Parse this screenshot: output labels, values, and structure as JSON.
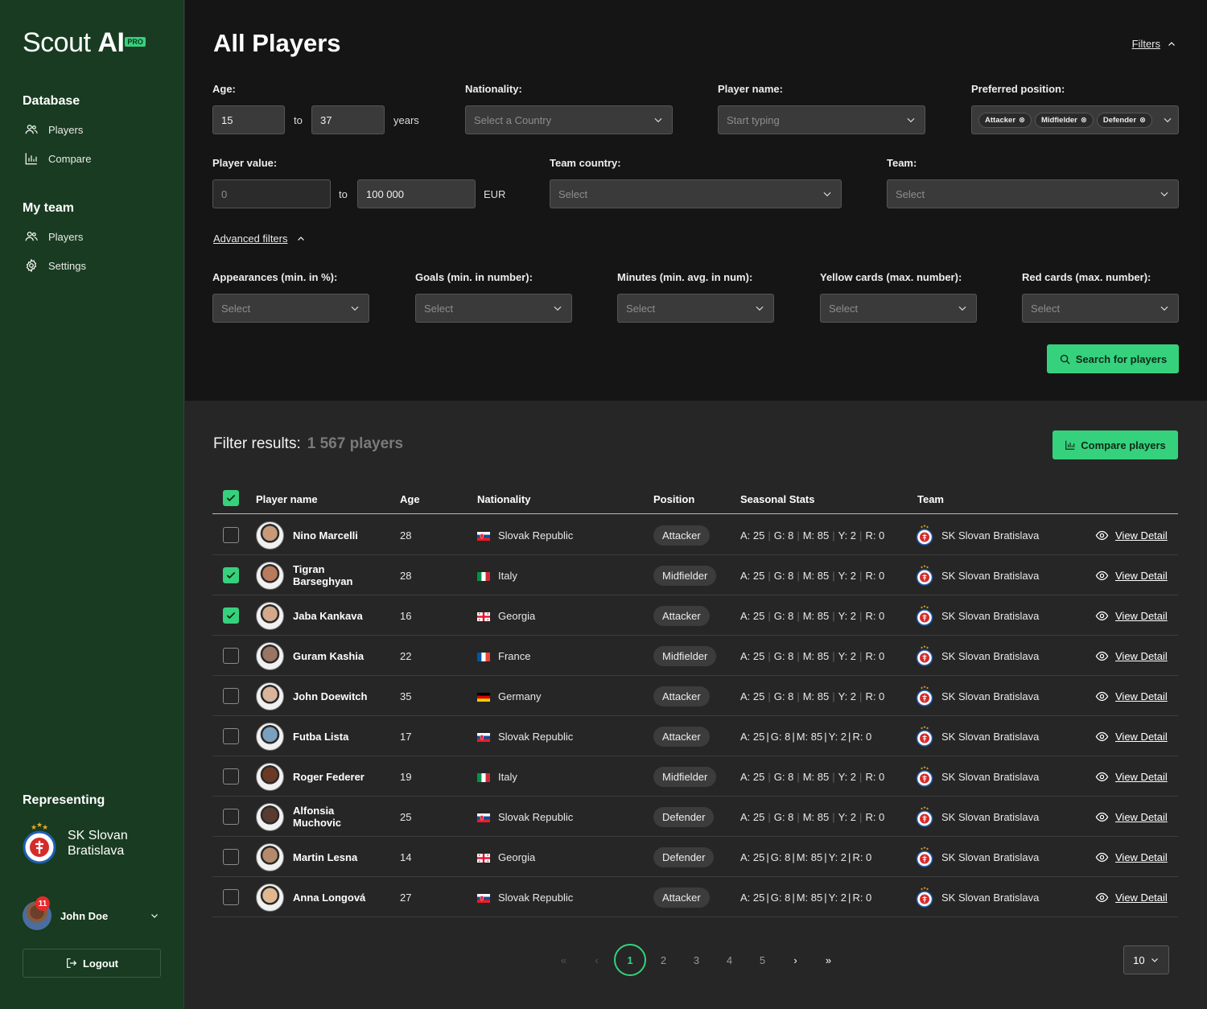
{
  "app": {
    "logo_text_light": "Scout ",
    "logo_text_bold": "AI",
    "logo_badge": "PRO"
  },
  "sidebar": {
    "database_heading": "Database",
    "database_items": [
      {
        "label": "Players",
        "icon": "users-icon"
      },
      {
        "label": "Compare",
        "icon": "bar-chart-icon"
      }
    ],
    "myteam_heading": "My team",
    "myteam_items": [
      {
        "label": "Players",
        "icon": "users-icon"
      },
      {
        "label": "Settings",
        "icon": "gear-icon"
      }
    ],
    "representing_heading": "Representing",
    "club_name": "SK Slovan Bratislava",
    "user_name": "John Doe",
    "notification_count": "11",
    "logout_label": "Logout"
  },
  "filters": {
    "page_title": "All Players",
    "toggle_label": "Filters",
    "age_label": "Age:",
    "age_from": "15",
    "age_to": "37",
    "to_word": "to",
    "years_word": "years",
    "nationality_label": "Nationality:",
    "nationality_placeholder": "Select a Country",
    "player_name_label": "Player name:",
    "player_name_placeholder": "Start typing",
    "position_label": "Preferred position:",
    "position_chips": [
      "Attacker",
      "Midfielder",
      "Defender"
    ],
    "value_label": "Player value:",
    "value_from_placeholder": "0",
    "value_to": "100 000",
    "currency": "EUR",
    "team_country_label": "Team country:",
    "team_label": "Team:",
    "select_placeholder": "Select",
    "advanced_label": "Advanced filters",
    "advanced": [
      "Appearances (min. in %):",
      "Goals (min. in number):",
      "Minutes (min. avg. in num):",
      "Yellow cards (max. number):",
      "Red cards (max. number):"
    ],
    "search_button": "Search for players"
  },
  "results": {
    "title": "Filter results:",
    "count": "1 567 players",
    "compare_button": "Compare players",
    "columns": [
      "Player name",
      "Age",
      "Nationality",
      "Position",
      "Seasonal Stats",
      "Team"
    ],
    "view_detail_label": "View Detail",
    "rows": [
      {
        "name": "Nino Marcelli",
        "age": "28",
        "nationality": "Slovak Republic",
        "flag": "sk",
        "position": "Attacker",
        "stats": [
          "A: 25",
          "G: 8",
          "M: 85",
          "Y: 2",
          "R: 0"
        ],
        "bold_sep": false,
        "team": "SK Slovan Bratislava",
        "checked": false,
        "avatar": "#c89a7a"
      },
      {
        "name": "Tigran Barseghyan",
        "age": "28",
        "nationality": "Italy",
        "flag": "it",
        "position": "Midfielder",
        "stats": [
          "A: 25",
          "G: 8",
          "M: 85",
          "Y: 2",
          "R: 0"
        ],
        "bold_sep": false,
        "team": "SK Slovan Bratislava",
        "checked": true,
        "avatar": "#b97b5d"
      },
      {
        "name": "Jaba Kankava",
        "age": "16",
        "nationality": "Georgia",
        "flag": "ge",
        "position": "Attacker",
        "stats": [
          "A: 25",
          "G: 8",
          "M: 85",
          "Y: 2",
          "R: 0"
        ],
        "bold_sep": false,
        "team": "SK Slovan Bratislava",
        "checked": true,
        "avatar": "#d4a88a"
      },
      {
        "name": "Guram Kashia",
        "age": "22",
        "nationality": "France",
        "flag": "fr",
        "position": "Midfielder",
        "stats": [
          "A: 25",
          "G: 8",
          "M: 85",
          "Y: 2",
          "R: 0"
        ],
        "bold_sep": false,
        "team": "SK Slovan Bratislava",
        "checked": false,
        "avatar": "#9a7564"
      },
      {
        "name": "John Doewitch",
        "age": "35",
        "nationality": "Germany",
        "flag": "de",
        "position": "Attacker",
        "stats": [
          "A: 25",
          "G: 8",
          "M: 85",
          "Y: 2",
          "R: 0"
        ],
        "bold_sep": false,
        "team": "SK Slovan Bratislava",
        "checked": false,
        "avatar": "#d8b49a"
      },
      {
        "name": "Futba Lista",
        "age": "17",
        "nationality": "Slovak Republic",
        "flag": "sk",
        "position": "Attacker",
        "stats": [
          "A: 25",
          "G: 8",
          "M: 85",
          "Y: 2",
          "R: 0"
        ],
        "bold_sep": true,
        "team": "SK Slovan Bratislava",
        "checked": false,
        "avatar": "#7aa0c0"
      },
      {
        "name": "Roger Federer",
        "age": "19",
        "nationality": "Italy",
        "flag": "it",
        "position": "Midfielder",
        "stats": [
          "A: 25",
          "G: 8",
          "M: 85",
          "Y: 2",
          "R: 0"
        ],
        "bold_sep": false,
        "team": "SK Slovan Bratislava",
        "checked": false,
        "avatar": "#6a3a24"
      },
      {
        "name": "Alfonsia Muchovic",
        "age": "25",
        "nationality": "Slovak Republic",
        "flag": "sk",
        "position": "Defender",
        "stats": [
          "A: 25",
          "G: 8",
          "M: 85",
          "Y: 2",
          "R: 0"
        ],
        "bold_sep": false,
        "team": "SK Slovan Bratislava",
        "checked": false,
        "avatar": "#5a3a30"
      },
      {
        "name": "Martin Lesna",
        "age": "14",
        "nationality": "Georgia",
        "flag": "ge",
        "position": "Defender",
        "stats": [
          "A: 25",
          "G: 8",
          "M: 85",
          "Y: 2",
          "R: 0"
        ],
        "bold_sep": true,
        "team": "SK Slovan Bratislava",
        "checked": false,
        "avatar": "#b58a6c"
      },
      {
        "name": "Anna Longová",
        "age": "27",
        "nationality": "Slovak Republic",
        "flag": "sk",
        "position": "Attacker",
        "stats": [
          "A: 25",
          "G: 8",
          "M: 85",
          "Y: 2",
          "R: 0"
        ],
        "bold_sep": true,
        "team": "SK Slovan Bratislava",
        "checked": false,
        "avatar": "#e0b890"
      }
    ]
  },
  "pagination": {
    "pages": [
      "1",
      "2",
      "3",
      "4",
      "5"
    ],
    "current": "1",
    "per_page": "10"
  },
  "colors": {
    "accent": "#36d17d",
    "sidebar": "#183b21",
    "panel": "#151515",
    "background": "#262626"
  }
}
